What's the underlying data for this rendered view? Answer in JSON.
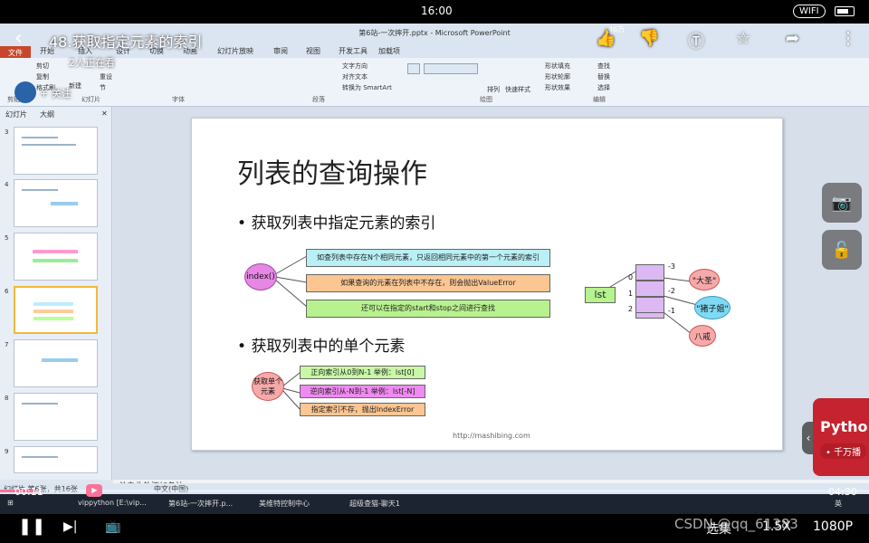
{
  "status_bar": {
    "time": "16:00",
    "wifi": "WIFI"
  },
  "video": {
    "title": "48.获取指定元素的索引",
    "watching": "2人正在看",
    "follow": "+ 关注",
    "likes": "46万",
    "current_time": "00:11",
    "total_time": "04:30",
    "progress_fraction": 0.041,
    "controls": {
      "episodes": "选集",
      "speed": "1.5X",
      "quality": "1080P"
    },
    "watermark": "CSDN @qq_61383"
  },
  "ppt": {
    "window_title": "第6站-一次摔开.pptx - Microsoft PowerPoint",
    "menu": [
      "文件",
      "开始",
      "插入",
      "设计",
      "切换",
      "动画",
      "幻灯片放映",
      "审阅",
      "视图",
      "开发工具",
      "加载项"
    ],
    "ribbon": {
      "groups": [
        "剪贴板",
        "幻灯片",
        "字体",
        "段落",
        "绘图",
        "编辑"
      ],
      "buttons": [
        "剪切",
        "复制",
        "格式刷",
        "新建",
        "重设",
        "节",
        "文字方向",
        "对齐文本",
        "转换为 SmartArt",
        "排列",
        "快速样式",
        "形状填充",
        "形状轮廓",
        "形状效果",
        "查找",
        "替换",
        "选择"
      ]
    },
    "pane_tabs": [
      "幻灯片",
      "大纲"
    ],
    "thumb_numbers": [
      "3",
      "4",
      "5",
      "6",
      "7",
      "8",
      "9"
    ],
    "notes_placeholder": "单击此处添加备注",
    "status_left": "幻灯片 第6张，共16张",
    "status_lang": "中文(中国)"
  },
  "slide": {
    "title": "列表的查询操作",
    "bullet1": "获取列表中指定元素的索引",
    "index_cloud": "index()",
    "index_boxes": [
      {
        "text": "如查列表中存在N个相同元素，只返回相同元素中的第一个元素的索引",
        "color": "#b9f0f6"
      },
      {
        "text": "如果查询的元素在列表中不存在，则会抛出ValueError",
        "color": "#fbc692"
      },
      {
        "text": "还可以在指定的start和stop之间进行查找",
        "color": "#b8f28f"
      }
    ],
    "lst_label": "lst",
    "positive_indices": [
      "0",
      "1",
      "2"
    ],
    "negative_indices": [
      "-3",
      "-2",
      "-1"
    ],
    "element_clouds": [
      "\"大圣\"",
      "\"猪子姐\"",
      "八戒"
    ],
    "bullet2": "获取列表中的单个元素",
    "get_cloud": "获取单个元素",
    "get_boxes": [
      {
        "text": "正向索引从0到N-1    举例：lst[0]",
        "color": "#c9f7a6"
      },
      {
        "text": "逆向索引从-N到-1    举例：lst[-N]",
        "color": "#ef8af0"
      },
      {
        "text": "指定索引不存，抛出IndexError",
        "color": "#fbc692"
      }
    ],
    "url": "http://mashibing.com"
  },
  "taskbar": {
    "items": [
      "vippython [E:\\vip...",
      "第6站-一次摔开.p...",
      "美维特控制中心",
      "超级查猫-聊天1"
    ],
    "clock": "英"
  },
  "promo": {
    "title": "Pytho",
    "badge": "• 千万播"
  },
  "colors": {
    "accent": "#fb7299",
    "file_tab": "#c8472a"
  }
}
